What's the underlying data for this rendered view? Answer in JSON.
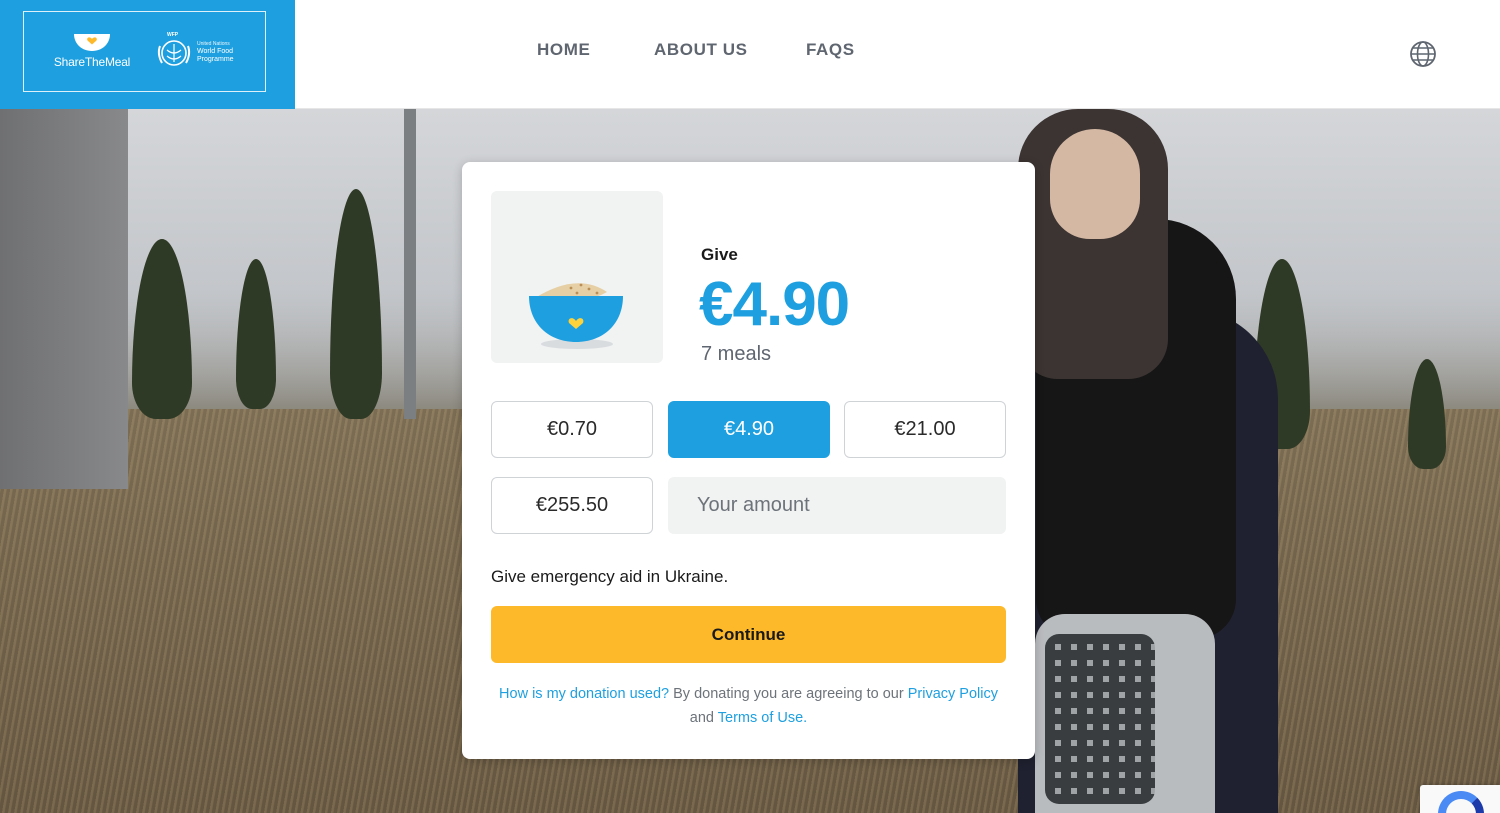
{
  "brand": {
    "name": "ShareTheMeal",
    "partner_top": "WFP",
    "partner_line1": "United Nations",
    "partner_line2": "World Food",
    "partner_line3": "Programme",
    "color": "#1ea0e0"
  },
  "nav": {
    "items": [
      {
        "label": "HOME"
      },
      {
        "label": "ABOUT US"
      },
      {
        "label": "FAQS"
      }
    ],
    "language_icon": "globe-icon"
  },
  "donation": {
    "give_label": "Give",
    "amount": "€4.90",
    "meals": "7 meals",
    "meal_icon": "bowl-icon",
    "options": [
      {
        "label": "€0.70",
        "selected": false
      },
      {
        "label": "€4.90",
        "selected": true
      },
      {
        "label": "€21.00",
        "selected": false
      },
      {
        "label": "€255.50",
        "selected": false
      }
    ],
    "custom_placeholder": "Your amount",
    "cause": "Give emergency aid in Ukraine.",
    "continue_label": "Continue",
    "continue_color": "#fdb92a"
  },
  "legal": {
    "how_link": "How is my donation used?",
    "agree_text": " By donating you are agreeing to our ",
    "privacy_link": "Privacy Policy",
    "and_text": "and ",
    "terms_link": "Terms of Use.",
    "link_color": "#1ea0e0"
  }
}
